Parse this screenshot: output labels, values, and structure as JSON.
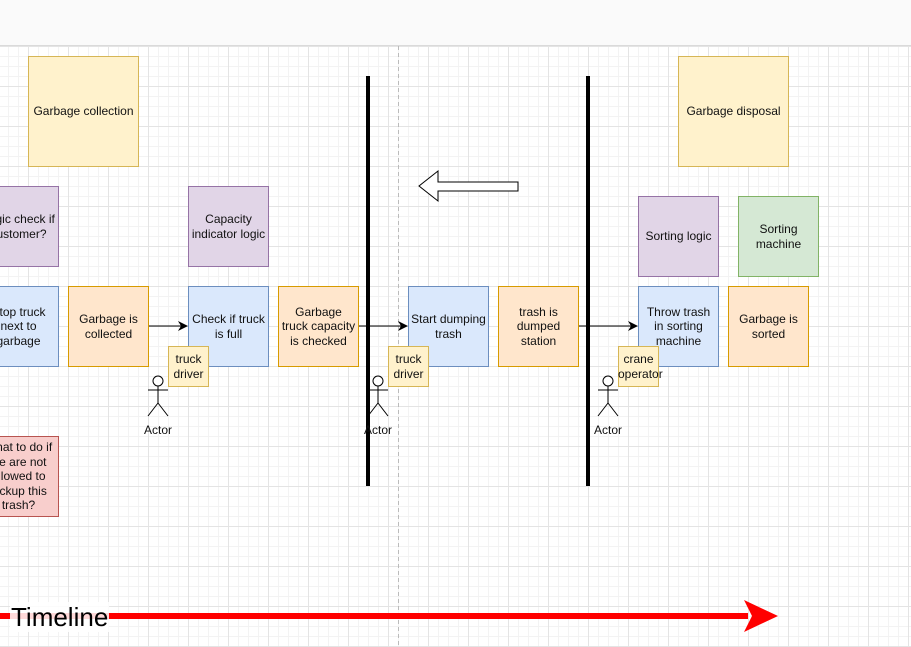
{
  "boxes": {
    "garbage_collection": "Garbage collection",
    "garbage_disposal": "Garbage disposal",
    "logic_check_customer": "Logic check if customer?",
    "capacity_indicator_logic": "Capacity indicator logic",
    "sorting_logic": "Sorting logic",
    "sorting_machine": "Sorting machine",
    "stop_truck": "Stop truck next to garbage",
    "garbage_collected": "Garbage is collected",
    "check_truck_full": "Check if truck is full",
    "capacity_checked": "Garbage truck capacity is checked",
    "start_dumping": "Start dumping trash",
    "trash_dumped": "trash is dumped station",
    "throw_trash": "Throw trash in sorting machine",
    "garbage_sorted": "Garbage is sorted",
    "not_allowed": "What to do if we are not allowed to pickup this trash?"
  },
  "stickies": {
    "truck_driver_1": "truck driver",
    "truck_driver_2": "truck driver",
    "crane_operator": "crane operator"
  },
  "actors": [
    "Actor",
    "Actor",
    "Actor"
  ],
  "timeline": {
    "label": "Timeline",
    "color": "#ff0000"
  },
  "colors": {
    "yellow": "#fff2cc",
    "purple": "#e1d5e7",
    "blue": "#dae8fc",
    "orange": "#ffe6cc",
    "green": "#d5e8d4",
    "red": "#f8cecc"
  }
}
